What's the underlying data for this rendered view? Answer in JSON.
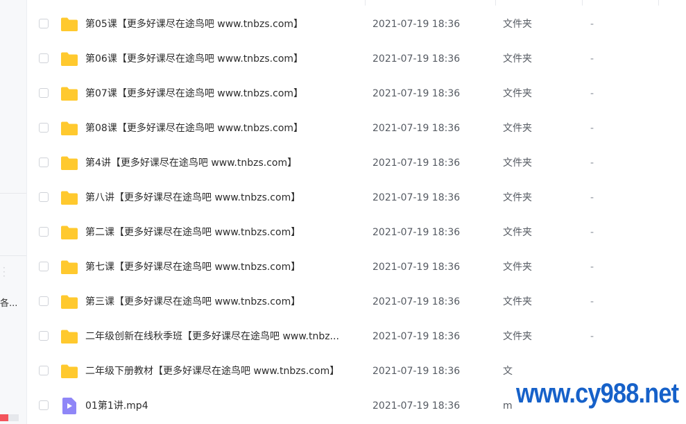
{
  "sidebar": {
    "truncated_label": "各...",
    "quota_fraction": 0.45,
    "quota_color": "#f3545c"
  },
  "files": [
    {
      "icon": "folder-icon",
      "name": "第05课【更多好课尽在途鸟吧 www.tnbzs.com】",
      "modified": "2021-07-19 18:36",
      "type": "文件夹",
      "size": "-"
    },
    {
      "icon": "folder-icon",
      "name": "第06课【更多好课尽在途鸟吧 www.tnbzs.com】",
      "modified": "2021-07-19 18:36",
      "type": "文件夹",
      "size": "-"
    },
    {
      "icon": "folder-icon",
      "name": "第07课【更多好课尽在途鸟吧 www.tnbzs.com】",
      "modified": "2021-07-19 18:36",
      "type": "文件夹",
      "size": "-"
    },
    {
      "icon": "folder-icon",
      "name": "第08课【更多好课尽在途鸟吧 www.tnbzs.com】",
      "modified": "2021-07-19 18:36",
      "type": "文件夹",
      "size": "-"
    },
    {
      "icon": "folder-icon",
      "name": "第4讲【更多好课尽在途鸟吧 www.tnbzs.com】",
      "modified": "2021-07-19 18:36",
      "type": "文件夹",
      "size": "-"
    },
    {
      "icon": "folder-icon",
      "name": "第八讲【更多好课尽在途鸟吧 www.tnbzs.com】",
      "modified": "2021-07-19 18:36",
      "type": "文件夹",
      "size": "-"
    },
    {
      "icon": "folder-icon",
      "name": "第二课【更多好课尽在途鸟吧 www.tnbzs.com】",
      "modified": "2021-07-19 18:36",
      "type": "文件夹",
      "size": "-"
    },
    {
      "icon": "folder-icon",
      "name": "第七课【更多好课尽在途鸟吧 www.tnbzs.com】",
      "modified": "2021-07-19 18:36",
      "type": "文件夹",
      "size": "-"
    },
    {
      "icon": "folder-icon",
      "name": "第三课【更多好课尽在途鸟吧 www.tnbzs.com】",
      "modified": "2021-07-19 18:36",
      "type": "文件夹",
      "size": "-"
    },
    {
      "icon": "folder-icon",
      "name": "二年级创新在线秋季班【更多好课尽在途鸟吧 www.tnbz...",
      "modified": "2021-07-19 18:36",
      "type": "文件夹",
      "size": "-"
    },
    {
      "icon": "folder-icon",
      "name": "二年级下册教材【更多好课尽在途鸟吧 www.tnbzs.com】",
      "modified": "2021-07-19 18:36",
      "type": "文",
      "size": ""
    },
    {
      "icon": "video-file-icon",
      "name": "01第1讲.mp4",
      "modified": "2021-07-19 18:36",
      "type": "m",
      "size": ""
    }
  ],
  "watermark": "www.cy988.net",
  "colors": {
    "folder": "#ffc92e",
    "video": "#8f86f7",
    "watermark": "#1661c9"
  }
}
